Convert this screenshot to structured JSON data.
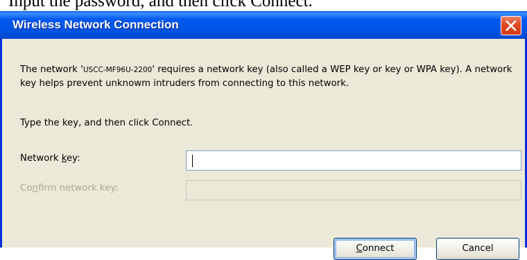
{
  "caption": {
    "text": "Input the password, and then click Connect."
  },
  "window": {
    "title": "Wireless Network Connection",
    "close_icon": "close-icon"
  },
  "message": {
    "prefix": "The network '",
    "ssid": "USCC-MF96U-2200",
    "suffix": "' requires a network key (also called a WEP key or key or WPA key). A network key helps prevent unknowm intruders from connecting to this network."
  },
  "instruction": "Type the key, and then click Connect.",
  "fields": {
    "network_key": {
      "label_pre": "Network ",
      "label_accel": "k",
      "label_post": "ey:",
      "value": ""
    },
    "confirm_key": {
      "label_pre": "Co",
      "label_accel": "n",
      "label_post": "firm network key:",
      "value": ""
    }
  },
  "buttons": {
    "connect": {
      "accel": "C",
      "rest": "onnect"
    },
    "cancel": {
      "label": "Cancel"
    }
  },
  "colors": {
    "titlebar": "#0054E3",
    "dialog_bg": "#ECE9D8",
    "disabled_text": "#ACA899",
    "close_button": "#E2471F"
  }
}
